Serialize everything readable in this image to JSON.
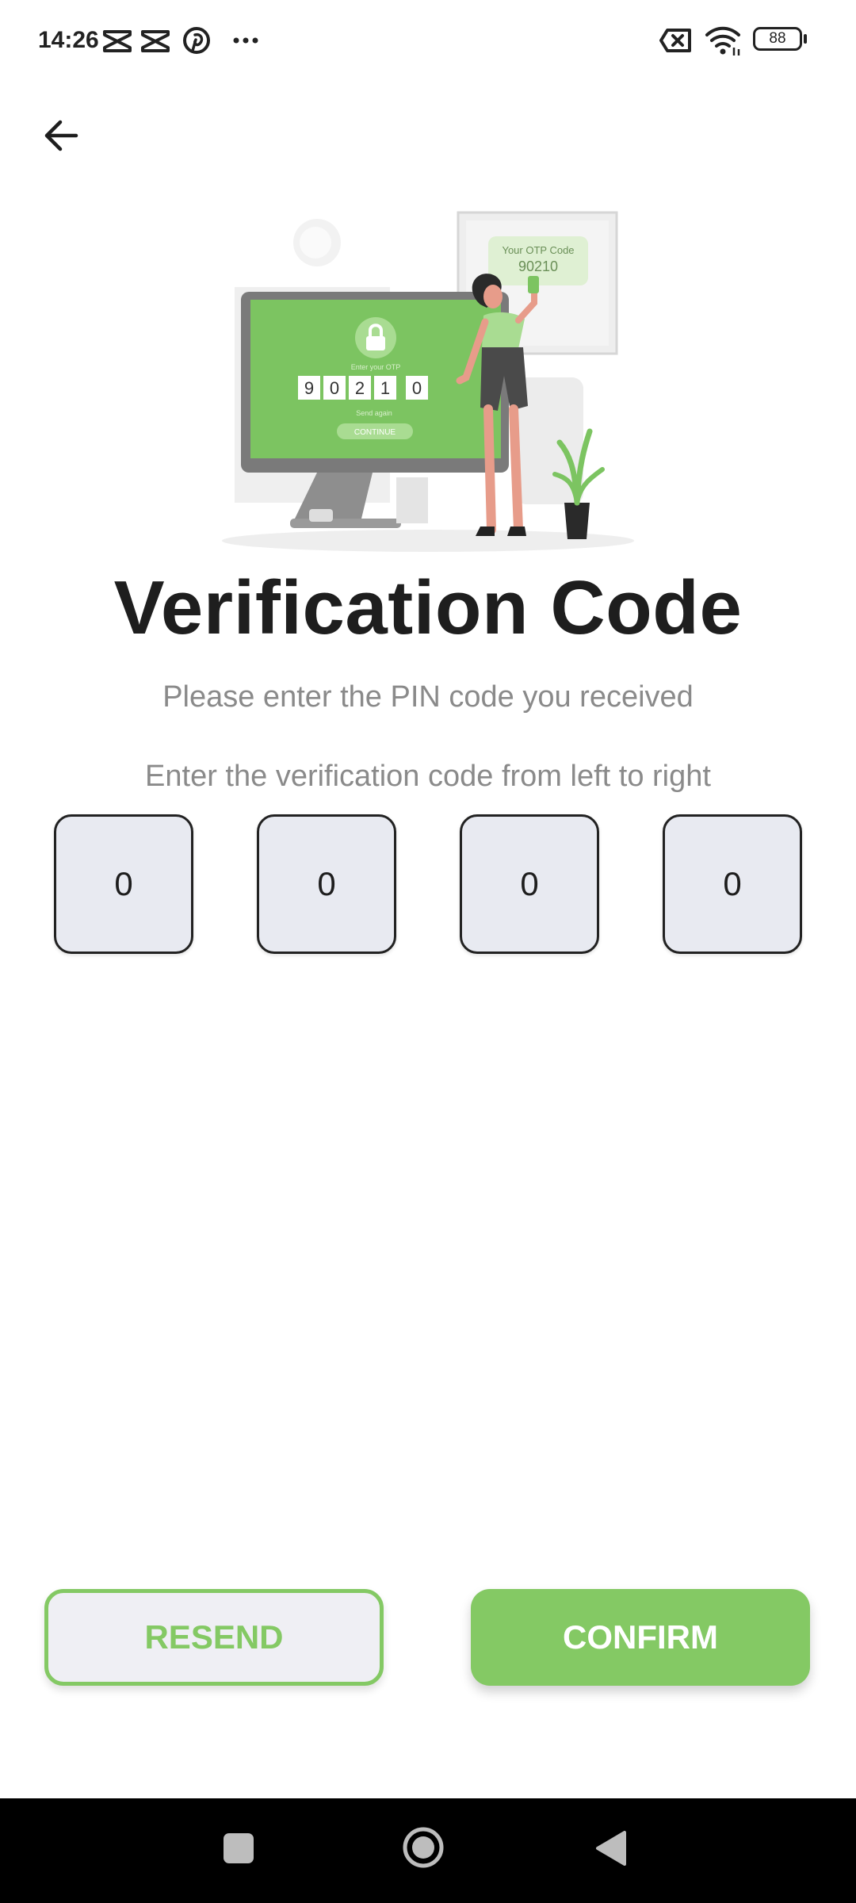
{
  "status_bar": {
    "time": "14:26",
    "left_icons": [
      "capcut-icon",
      "capcut-icon",
      "pinterest-icon",
      "more-dots-icon"
    ],
    "right_icons": [
      "sim-x-icon",
      "wifi-icon",
      "battery-icon"
    ],
    "battery": "88"
  },
  "header": {
    "back_icon": "arrow-left-icon"
  },
  "illustration": {
    "otp_card_label": "Your OTP Code",
    "otp_card_code": "90210",
    "screen_prompt": "Enter your OTP",
    "screen_digits": [
      "9",
      "0",
      "2",
      "1",
      "0"
    ],
    "screen_send_again": "Send again",
    "screen_continue": "CONTINUE"
  },
  "main": {
    "title": "Verification Code",
    "subtitle": "Please enter the PIN code you received",
    "instruction": "Enter the verification code from left to right",
    "pin_digits": [
      "0",
      "0",
      "0",
      "0"
    ]
  },
  "actions": {
    "resend_label": "RESEND",
    "confirm_label": "CONFIRM"
  },
  "colors": {
    "accent": "#84c964",
    "pin_background": "#e8eaf1",
    "text_primary": "#1e1e1e",
    "text_secondary": "#8a8a8a",
    "nav_bar": "#000000"
  },
  "nav_bar": {
    "icons": [
      "recents-square-icon",
      "home-circle-icon",
      "back-triangle-icon"
    ]
  }
}
